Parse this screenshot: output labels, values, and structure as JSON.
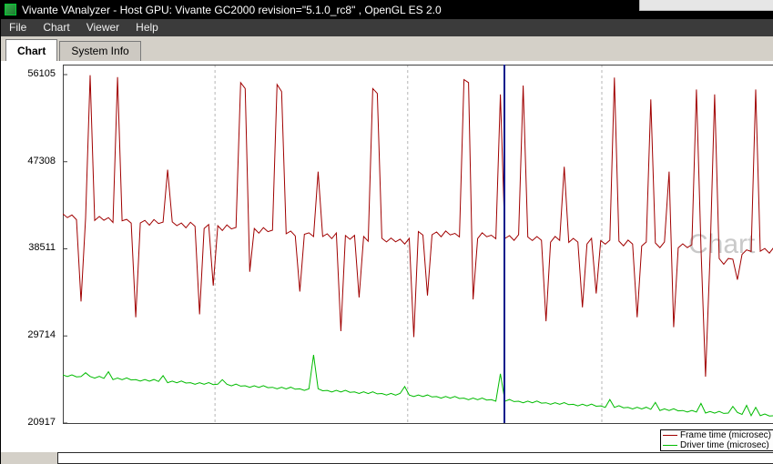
{
  "window": {
    "title": "Vivante VAnalyzer - Host GPU: Vivante GC2000 revision=\"5.1.0_rc8\" , OpenGL ES 2.0"
  },
  "menu": {
    "items": [
      "File",
      "Chart",
      "Viewer",
      "Help"
    ]
  },
  "tabs": [
    {
      "label": "Chart",
      "active": true
    },
    {
      "label": "System Info",
      "active": false
    }
  ],
  "chart_data": {
    "type": "line",
    "title": "",
    "watermark": "Chart",
    "xlabel": "",
    "ylabel": "",
    "ylim": [
      20917,
      56105
    ],
    "y_ticks": [
      56105,
      47308,
      38511,
      29714,
      20917
    ],
    "grid": "vertical-dashed",
    "gridline_fractions": [
      0.214,
      0.485,
      0.758
    ],
    "cursor_x_fraction": 0.621,
    "cursor_color": "#001a8c",
    "legend": {
      "position": "bottom-right",
      "entries": [
        {
          "label": "Frame time (microsec)",
          "color": "#a00000"
        },
        {
          "label": "Driver time (microsec)",
          "color": "#00bb00"
        }
      ]
    },
    "series": [
      {
        "name": "Frame time (microsec)",
        "color": "#a00000",
        "values": [
          42050,
          41666,
          41932,
          41448,
          33200,
          41610,
          56050,
          41382,
          41778,
          41394,
          41660,
          41176,
          55850,
          41338,
          41484,
          41110,
          31600,
          41122,
          41388,
          40904,
          41470,
          41066,
          41212,
          46500,
          41234,
          40850,
          41116,
          40632,
          41198,
          40794,
          31900,
          40566,
          40962,
          34800,
          40844,
          40360,
          40926,
          40522,
          40668,
          55300,
          54700,
          36200,
          40572,
          40088,
          40654,
          40250,
          40396,
          55100,
          54400,
          40034,
          40300,
          39816,
          34200,
          39978,
          40124,
          39750,
          46300,
          39762,
          40028,
          39544,
          40110,
          30200,
          39852,
          39478,
          39874,
          33600,
          39756,
          39272,
          54700,
          54200,
          39580,
          39206,
          39602,
          39218,
          39484,
          39000,
          39566,
          29600,
          40260,
          39897,
          33800,
          39931,
          40208,
          39735,
          40312,
          39919,
          40076,
          39713,
          55600,
          55300,
          33400,
          39551,
          40128,
          39735,
          39892,
          39529,
          54100,
          39563,
          39840,
          39367,
          39944,
          55000,
          39708,
          39345,
          39752,
          39379,
          31200,
          39183,
          39760,
          39367,
          46800,
          39161,
          39568,
          39195,
          32600,
          38999,
          39576,
          34000,
          39340,
          38977,
          39384,
          55800,
          39288,
          38815,
          39392,
          38999,
          31600,
          38793,
          39200,
          53600,
          39104,
          38631,
          39208,
          46300,
          30600,
          38609,
          39016,
          38643,
          38920,
          54600,
          38624,
          25600,
          37888,
          54100,
          37532,
          36959,
          37536,
          37463,
          35400,
          37947,
          38404,
          38241,
          54600,
          38275,
          38552,
          38079,
          38679
        ]
      },
      {
        "name": "Driver time (microsec)",
        "color": "#00bb00",
        "values": [
          25780,
          25614,
          25788,
          25582,
          25616,
          26000,
          25624,
          25458,
          25632,
          25426,
          26100,
          25304,
          25468,
          25302,
          25476,
          25270,
          25304,
          25148,
          25312,
          25146,
          25320,
          25114,
          25700,
          24992,
          25156,
          24990,
          25164,
          24958,
          24992,
          24836,
          25000,
          24834,
          25008,
          24802,
          24836,
          25300,
          24844,
          24678,
          24852,
          24646,
          24680,
          24524,
          24688,
          24522,
          24696,
          24490,
          24524,
          24368,
          24532,
          24366,
          24540,
          24334,
          24368,
          24212,
          24376,
          27800,
          24384,
          24178,
          24212,
          24056,
          24220,
          24054,
          24228,
          24022,
          24056,
          23900,
          24064,
          23898,
          24072,
          23866,
          23900,
          23744,
          23908,
          23742,
          23916,
          24600,
          23744,
          23588,
          23752,
          23586,
          23760,
          23554,
          23588,
          23432,
          23596,
          23430,
          23604,
          23398,
          23432,
          23276,
          23440,
          23274,
          23448,
          23242,
          23276,
          23120,
          25900,
          23118,
          23292,
          23086,
          23120,
          22964,
          23128,
          22962,
          23136,
          22930,
          22964,
          22808,
          22972,
          22806,
          22980,
          22774,
          22808,
          22652,
          22816,
          22650,
          22824,
          22618,
          22652,
          22496,
          23300,
          22494,
          22668,
          22462,
          22496,
          22340,
          22504,
          22338,
          22512,
          22306,
          23000,
          22184,
          22348,
          22182,
          22356,
          22150,
          22184,
          22028,
          22192,
          22026,
          22900,
          21924,
          22088,
          21922,
          22096,
          21890,
          21924,
          22600,
          21992,
          21786,
          22700,
          21664,
          22500,
          21662,
          21836,
          21630,
          21664
        ]
      }
    ]
  }
}
